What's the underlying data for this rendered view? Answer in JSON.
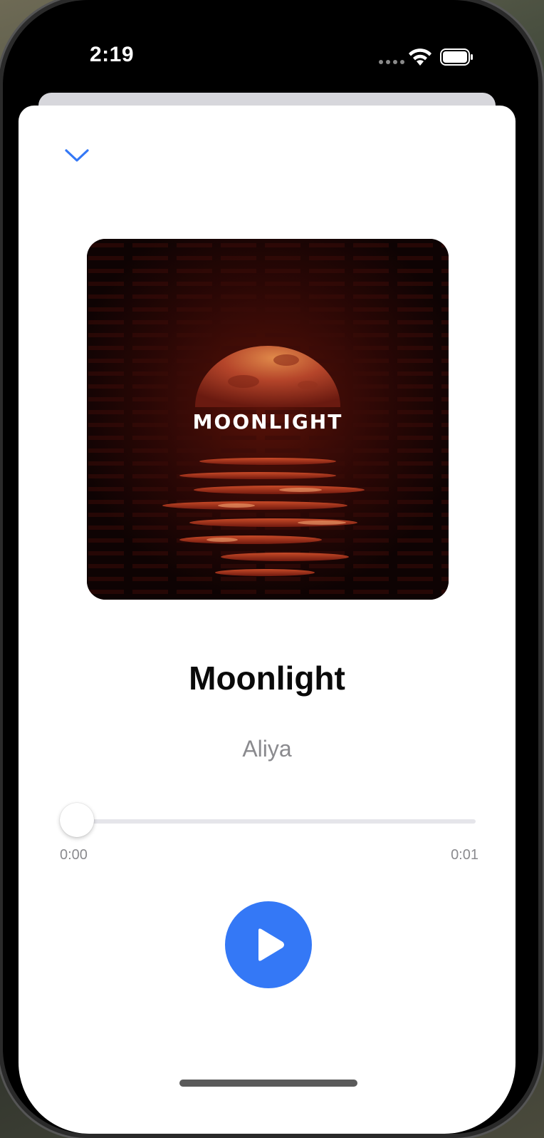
{
  "status_bar": {
    "time": "2:19",
    "wifi_icon": "wifi-icon",
    "battery_icon": "battery-icon"
  },
  "player": {
    "collapse_icon": "chevron-down-icon",
    "artwork_text": "MOONLIGHT",
    "title": "Moonlight",
    "artist": "Aliya",
    "progress": {
      "elapsed": "0:00",
      "total": "0:01",
      "fraction": 0.0
    },
    "play_icon": "play-icon"
  },
  "colors": {
    "accent": "#3478f6",
    "title": "#0a0a0a",
    "secondary_text": "#8a8a8e",
    "track": "#e5e5ea",
    "artwork_background": "#160606",
    "moon": "#a83a22"
  }
}
